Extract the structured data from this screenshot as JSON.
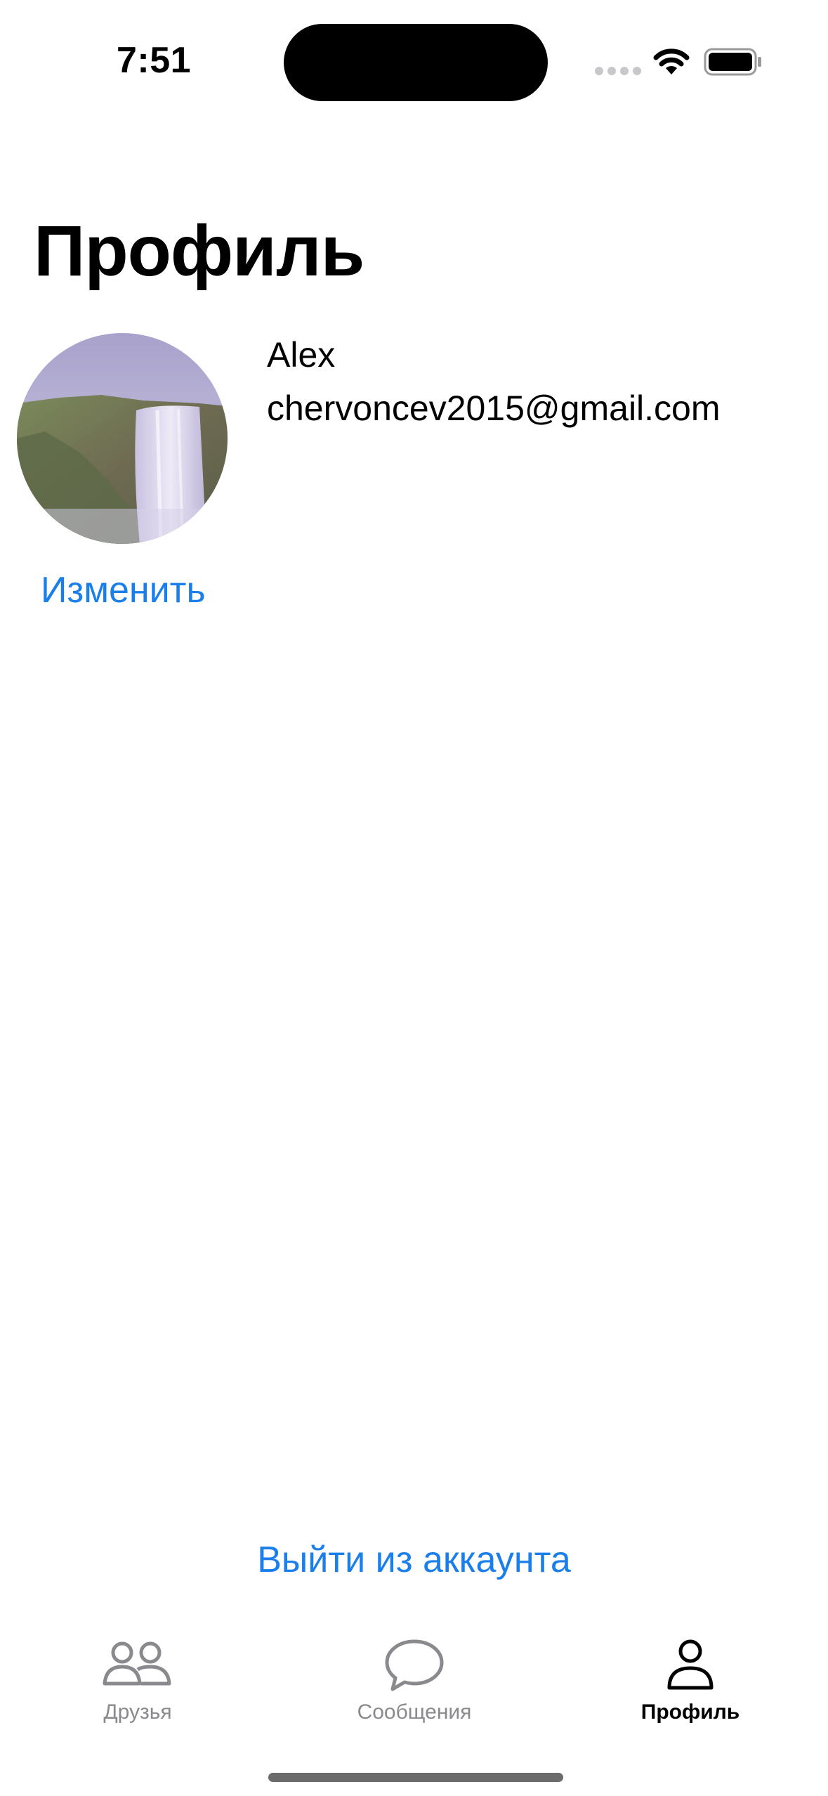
{
  "status_bar": {
    "time": "7:51",
    "icons": [
      "signal-dots-icon",
      "wifi-icon",
      "battery-icon"
    ]
  },
  "page": {
    "title": "Профиль"
  },
  "profile": {
    "avatar_icon": "waterfall-photo",
    "edit_label": "Изменить",
    "name": "Alex",
    "email": "chervoncev2015@gmail.com"
  },
  "logout": {
    "label": "Выйти из аккаунта"
  },
  "tabs": [
    {
      "label": "Друзья",
      "icon": "friends-icon",
      "active": false
    },
    {
      "label": "Сообщения",
      "icon": "chat-bubble-icon",
      "active": false
    },
    {
      "label": "Профиль",
      "icon": "person-icon",
      "active": true
    }
  ],
  "colors": {
    "accent": "#1a7fea",
    "tab_inactive": "#8a8a8e",
    "tab_active": "#000000"
  }
}
